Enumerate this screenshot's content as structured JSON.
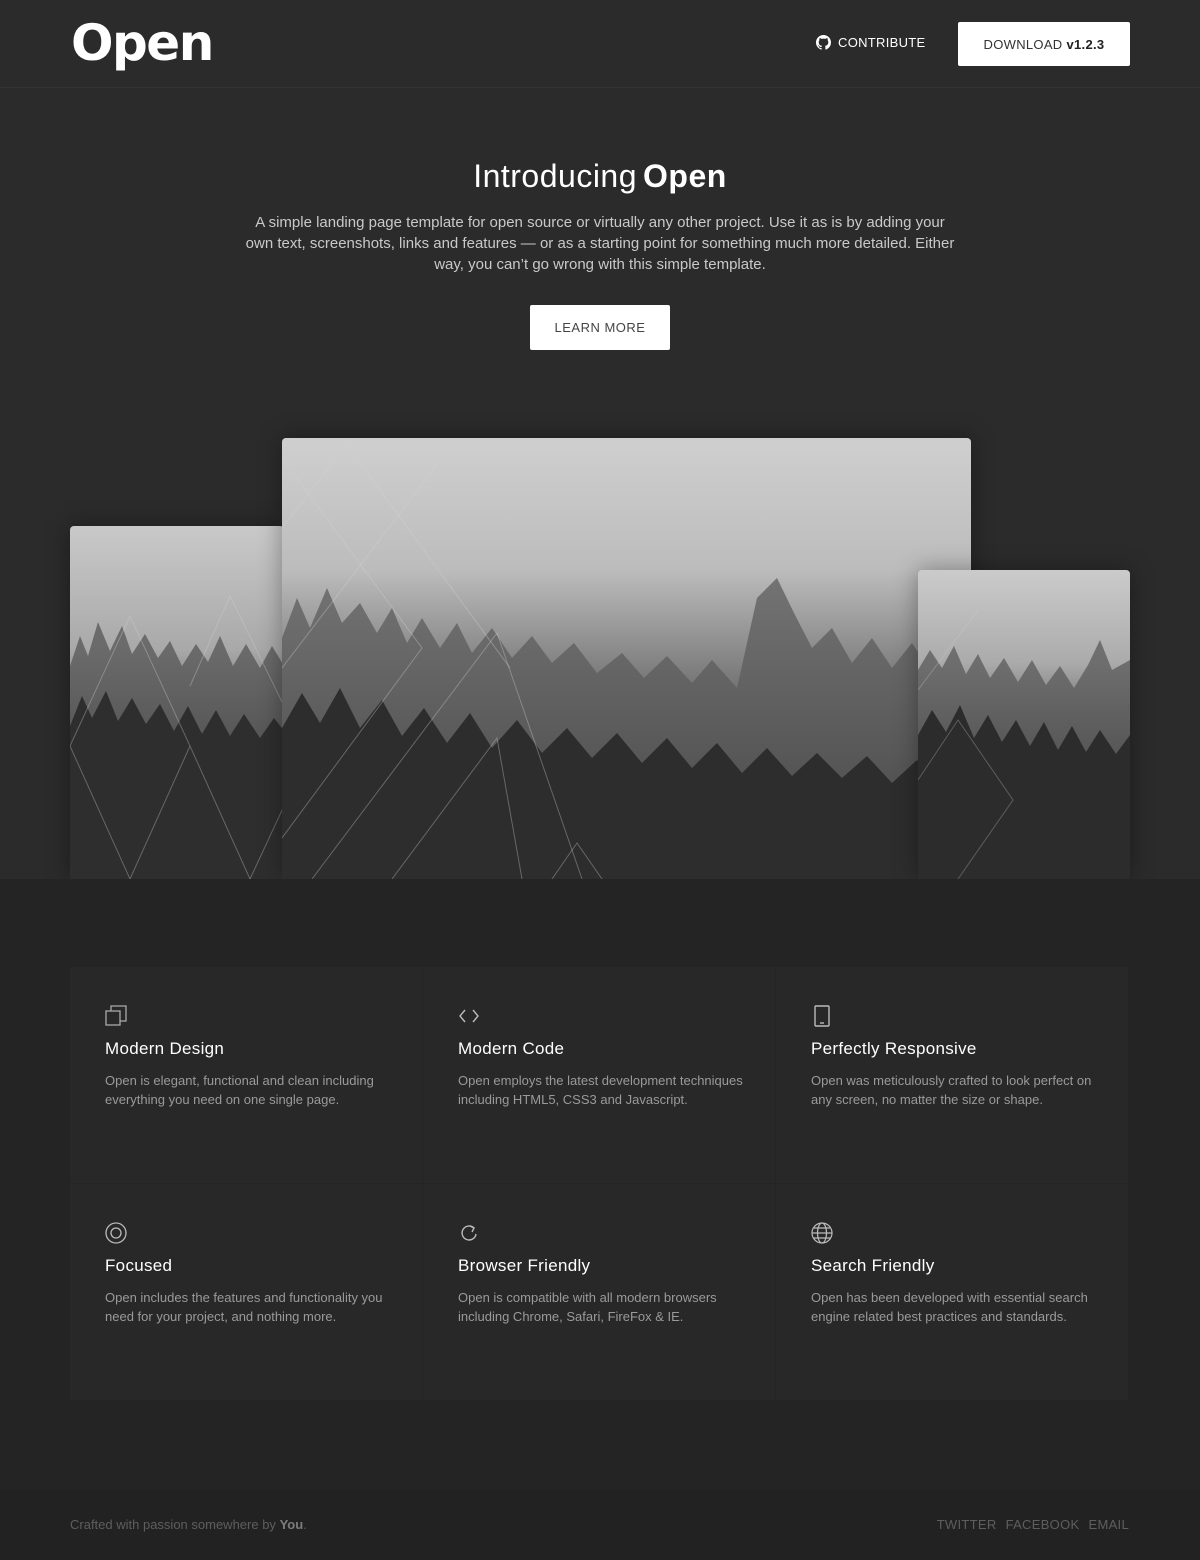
{
  "header": {
    "logo": "Open",
    "contribute_label": "CONTRIBUTE",
    "download_label": "DOWNLOAD",
    "download_version": "v1.2.3"
  },
  "hero": {
    "title_prefix": "Introducing",
    "title_strong": "Open",
    "description": "A simple landing page template for open source or virtually any other project. Use it as is by adding your own text, screenshots, links and features — or as a starting point for something much more detailed. Either way, you can’t go wrong with this simple template.",
    "cta_label": "LEARN MORE"
  },
  "features": [
    {
      "icon": "copy-icon",
      "title": "Modern Design",
      "text": "Open is elegant, functional and clean including everything you need on one single page."
    },
    {
      "icon": "code-icon",
      "title": "Modern Code",
      "text": "Open employs the latest development techniques including HTML5, CSS3 and Javascript."
    },
    {
      "icon": "tablet-icon",
      "title": "Perfectly Responsive",
      "text": "Open was meticulously crafted to look perfect on any screen, no matter the size or shape."
    },
    {
      "icon": "target-icon",
      "title": "Focused",
      "text": "Open includes the features and functionality you need for your project, and nothing more."
    },
    {
      "icon": "refresh-icon",
      "title": "Browser Friendly",
      "text": "Open is compatible with all modern browsers including Chrome, Safari, FireFox & IE."
    },
    {
      "icon": "globe-icon",
      "title": "Search Friendly",
      "text": "Open has been developed with essential search engine related best practices and standards."
    }
  ],
  "footer": {
    "credit_prefix": "Crafted with passion somewhere by",
    "credit_author": "You",
    "credit_suffix": ".",
    "links": [
      "TWITTER",
      "FACEBOOK",
      "EMAIL"
    ]
  }
}
